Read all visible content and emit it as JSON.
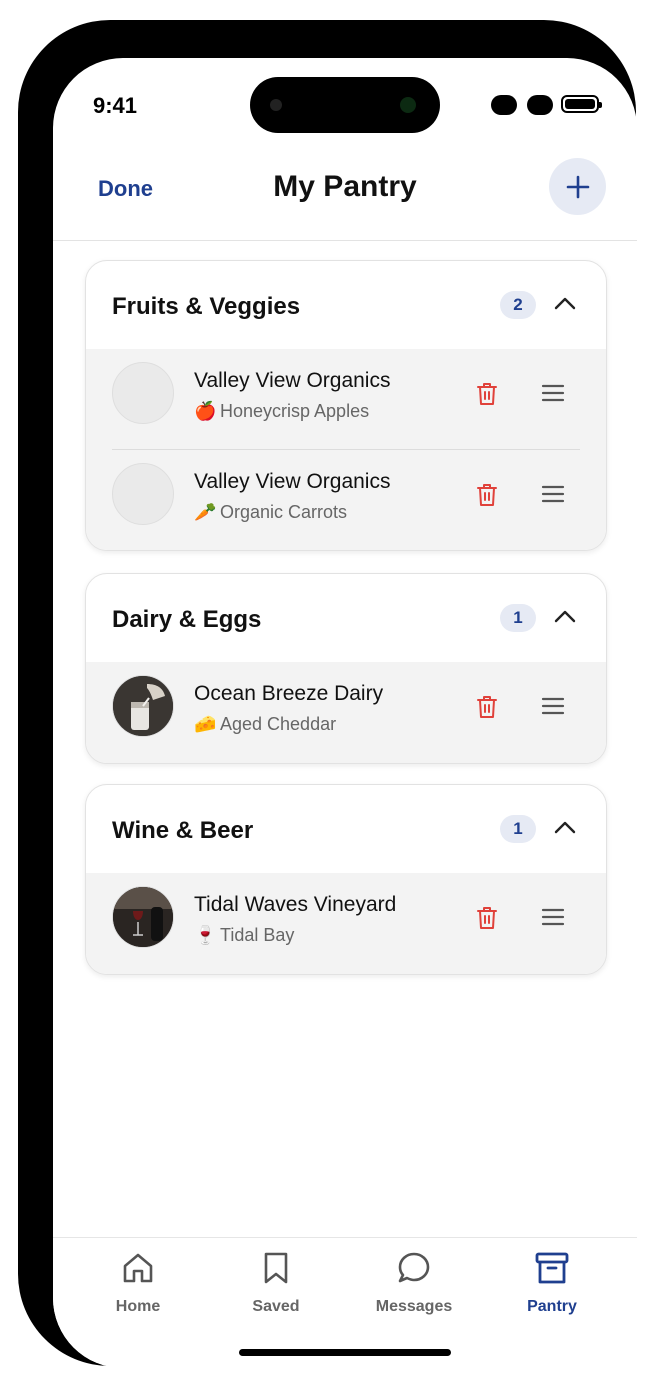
{
  "status_bar": {
    "time": "9:41"
  },
  "header": {
    "done_label": "Done",
    "title": "My Pantry"
  },
  "sections": [
    {
      "title": "Fruits & Veggies",
      "count": "2",
      "items": [
        {
          "vendor": "Valley View Organics",
          "emoji": "🍎",
          "product": "Honeycrisp Apples",
          "avatar": "placeholder"
        },
        {
          "vendor": "Valley View Organics",
          "emoji": "🥕",
          "product": "Organic Carrots",
          "avatar": "placeholder"
        }
      ]
    },
    {
      "title": "Dairy & Eggs",
      "count": "1",
      "items": [
        {
          "vendor": "Ocean Breeze Dairy",
          "emoji": "🧀",
          "product": "Aged Cheddar",
          "avatar": "milk-photo"
        }
      ]
    },
    {
      "title": "Wine & Beer",
      "count": "1",
      "items": [
        {
          "vendor": "Tidal Waves Vineyard",
          "emoji": "🍷",
          "product": "Tidal Bay",
          "avatar": "wine-photo"
        }
      ]
    }
  ],
  "tabbar": {
    "tabs": [
      {
        "label": "Home",
        "icon": "home-icon"
      },
      {
        "label": "Saved",
        "icon": "bookmark-icon"
      },
      {
        "label": "Messages",
        "icon": "chat-bubble-icon"
      },
      {
        "label": "Pantry",
        "icon": "archive-box-icon",
        "active": true
      }
    ]
  },
  "colors": {
    "accent": "#1f3f8f",
    "danger": "#e0413a",
    "badge_bg": "#e6eaf4",
    "row_bg": "#f3f3f3"
  }
}
